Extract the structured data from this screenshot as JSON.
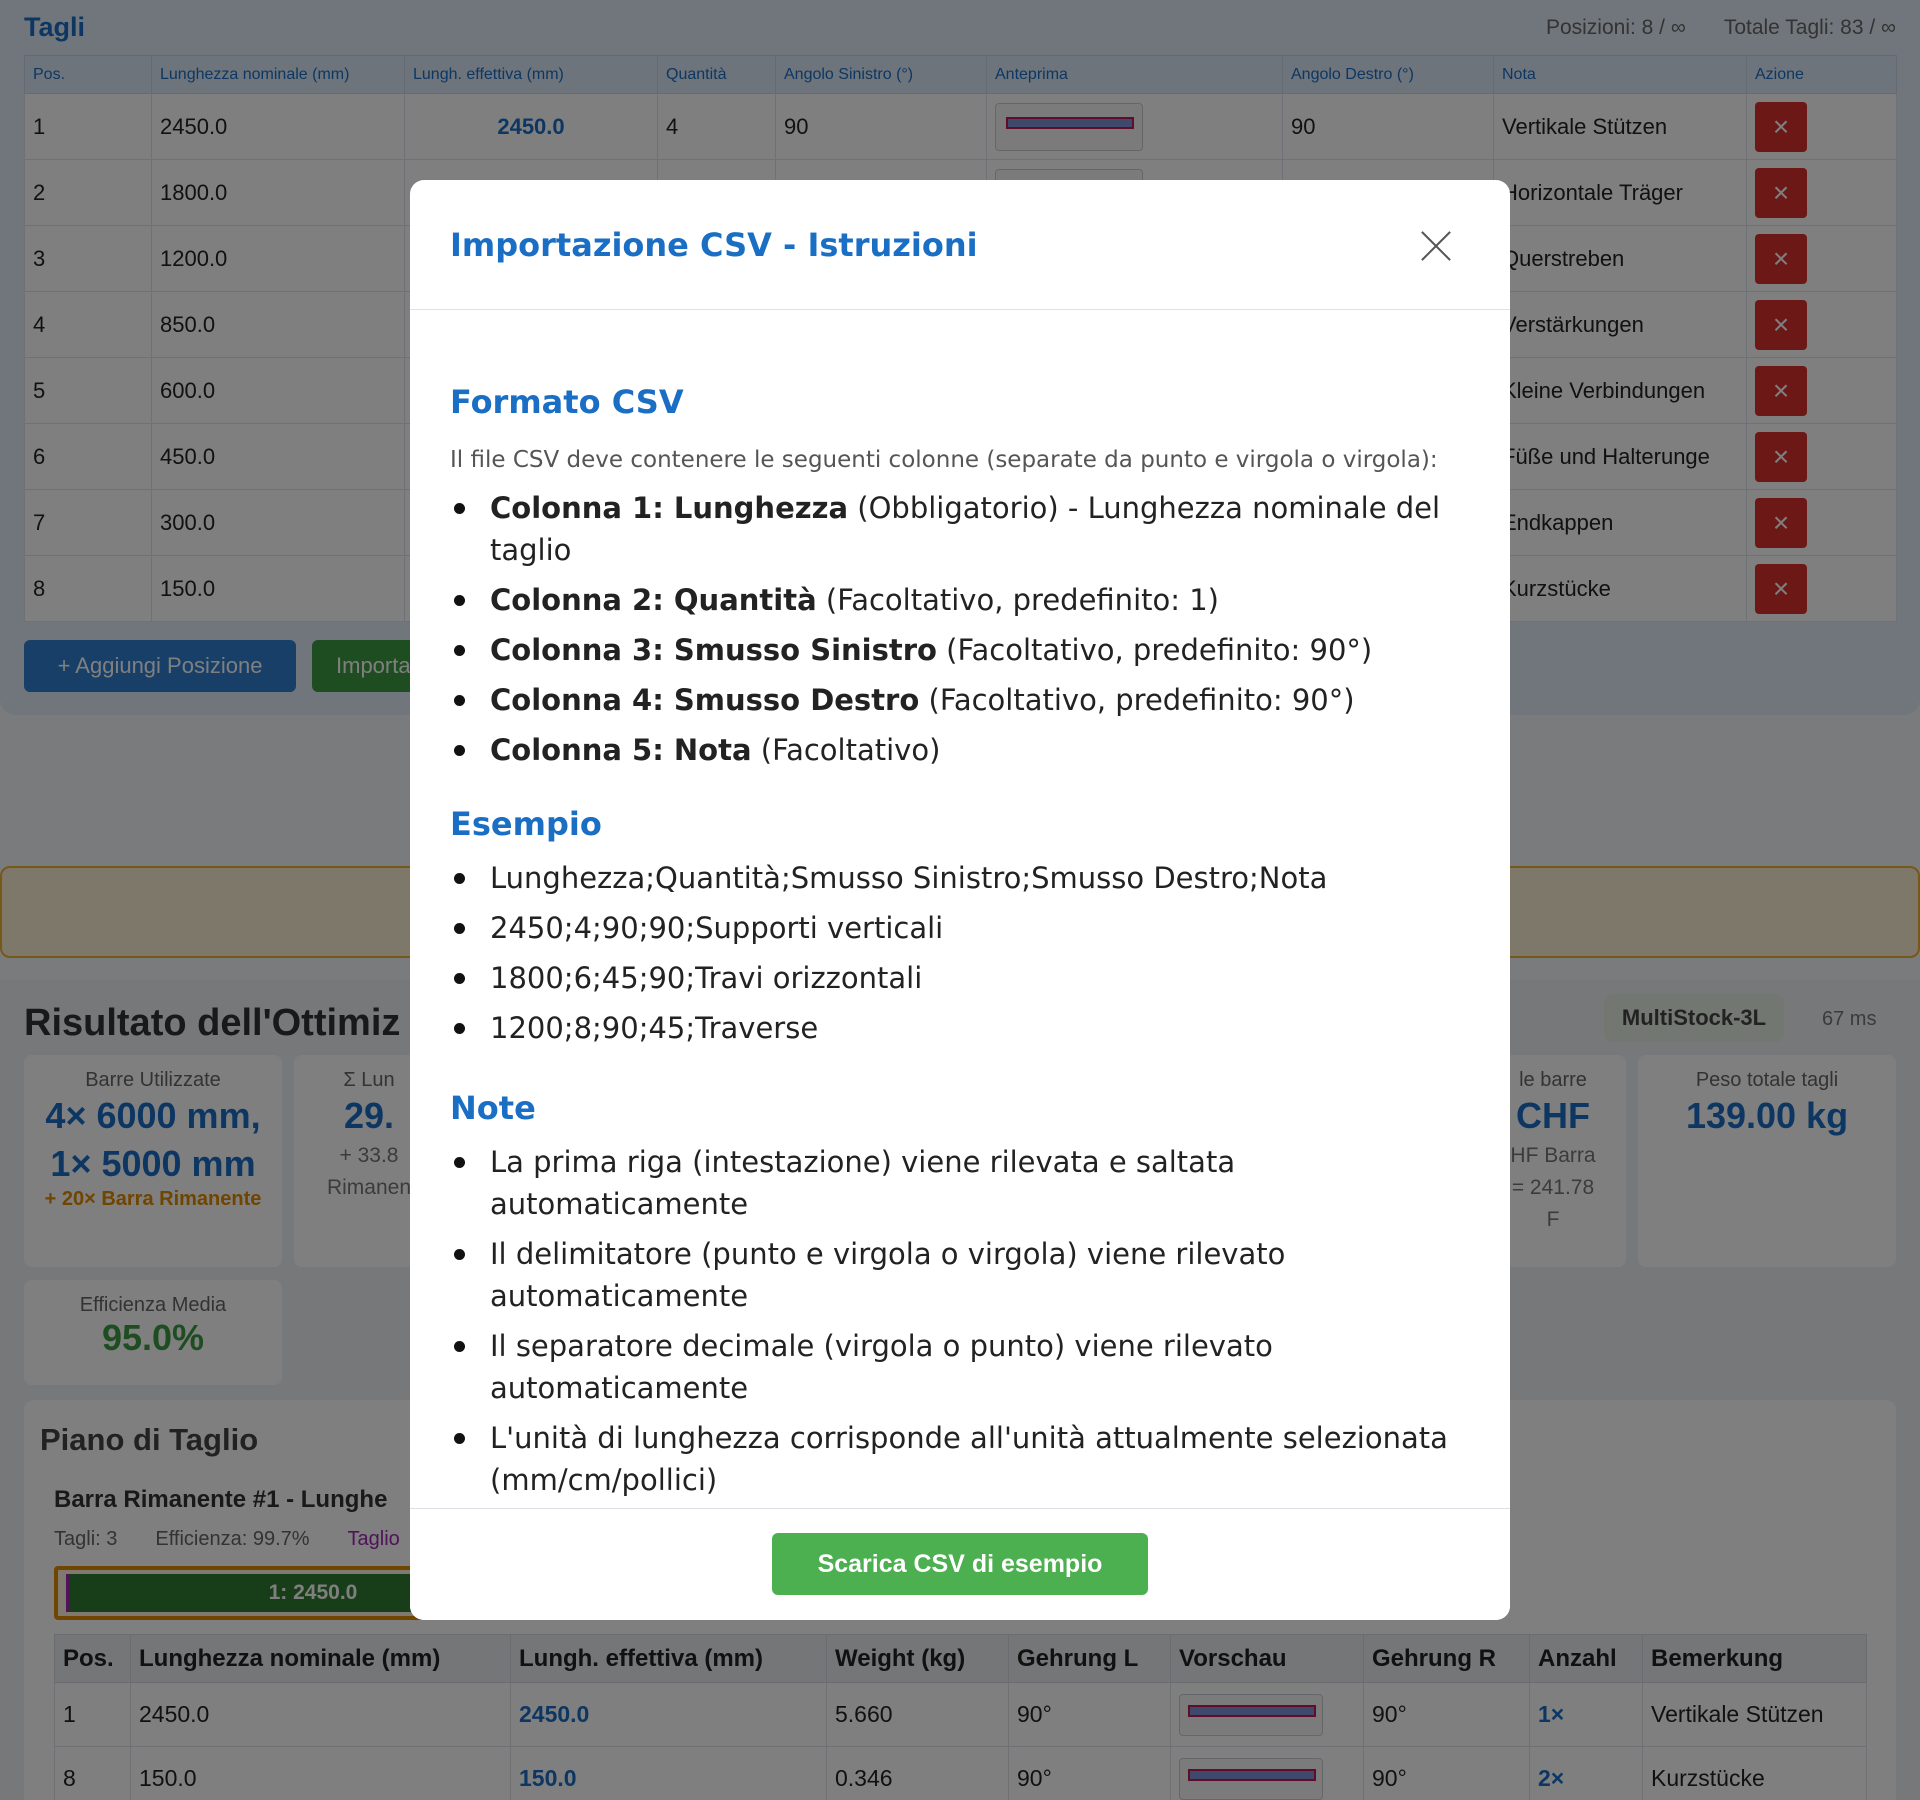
{
  "tagli": {
    "title": "Tagli",
    "positions": "Posizioni: 8 / ∞",
    "total": "Totale Tagli: 83 / ∞",
    "headers": [
      "Pos.",
      "Lunghezza nominale (mm)",
      "Lungh. effettiva (mm)",
      "Quantità",
      "Angolo Sinistro (°)",
      "Anteprima",
      "Angolo Destro (°)",
      "Nota",
      "Azione"
    ],
    "rows": [
      {
        "pos": "1",
        "len": "2450.0",
        "eff": "2450.0",
        "qty": "4",
        "angL": "90",
        "angR": "90",
        "note": "Vertikale Stützen"
      },
      {
        "pos": "2",
        "len": "1800.0",
        "eff": "",
        "qty": "",
        "angL": "",
        "angR": "",
        "note": "Horizontale Träger"
      },
      {
        "pos": "3",
        "len": "1200.0",
        "eff": "",
        "qty": "",
        "angL": "",
        "angR": "",
        "note": "Querstreben"
      },
      {
        "pos": "4",
        "len": "850.0",
        "eff": "",
        "qty": "",
        "angL": "",
        "angR": "",
        "note": "Verstärkungen"
      },
      {
        "pos": "5",
        "len": "600.0",
        "eff": "",
        "qty": "",
        "angL": "",
        "angR": "",
        "note": "Kleine Verbindungen"
      },
      {
        "pos": "6",
        "len": "450.0",
        "eff": "",
        "qty": "",
        "angL": "",
        "angR": "",
        "note": "Füße und Halterunge"
      },
      {
        "pos": "7",
        "len": "300.0",
        "eff": "",
        "qty": "",
        "angL": "",
        "angR": "",
        "note": "Endkappen"
      },
      {
        "pos": "8",
        "len": "150.0",
        "eff": "",
        "qty": "",
        "angL": "",
        "angR": "",
        "note": "Kurzstücke"
      }
    ],
    "delete_icon": "×",
    "add_button": "+ Aggiungi Posizione",
    "import_button": "Importa"
  },
  "results": {
    "title": "Risultato dell'Ottimiz",
    "algorithm": "MultiStock-3L",
    "time": "67 ms",
    "card1": {
      "label": "Barre Utilizzate",
      "line1": "4× 6000 mm,",
      "line2": "1× 5000 mm",
      "sub": "+ 20× Barra Rimanente"
    },
    "card2": {
      "label": "Σ Lun",
      "big": "29.",
      "small1": "+ 33.8",
      "small2": "Rimanen"
    },
    "card3": {
      "label": "le barre",
      "big": "CHF",
      "small1": "HF Barra",
      "small2": "= 241.78",
      "small3": "F"
    },
    "card4": {
      "label": "Peso totale tagli",
      "big": "139.00 kg"
    },
    "card5": {
      "label": "Efficienza Media",
      "big": "95.0%"
    }
  },
  "plan": {
    "title": "Piano di Taglio",
    "bar_name": "Barra Rimanente #1 - Lunghe",
    "meta_cuts": "Tagli: 3",
    "meta_eff": "Efficienza: 99.7%",
    "meta_extra": "Taglio",
    "segment_label": "1: 2450.0",
    "headers": [
      "Pos.",
      "Lunghezza nominale (mm)",
      "Lungh. effettiva (mm)",
      "Weight (kg)",
      "Gehrung L",
      "Vorschau",
      "Gehrung R",
      "Anzahl",
      "Bemerkung"
    ],
    "rows": [
      {
        "pos": "1",
        "len": "2450.0",
        "eff": "2450.0",
        "w": "5.660",
        "gl": "90°",
        "gr": "90°",
        "cnt": "1×",
        "note": "Vertikale Stützen"
      },
      {
        "pos": "8",
        "len": "150.0",
        "eff": "150.0",
        "w": "0.346",
        "gl": "90°",
        "gr": "90°",
        "cnt": "2×",
        "note": "Kurzstücke"
      }
    ]
  },
  "modal": {
    "title": "Importazione CSV - Istruzioni",
    "close_icon": "close-icon",
    "format_title": "Formato CSV",
    "format_intro": "Il file CSV deve contenere le seguenti colonne (separate da punto e virgola o virgola):",
    "columns": [
      {
        "bold": "Colonna 1: Lunghezza",
        "rest": " (Obbligatorio) - Lunghezza nominale del taglio"
      },
      {
        "bold": "Colonna 2: Quantità",
        "rest": " (Facoltativo, predefinito: 1)"
      },
      {
        "bold": "Colonna 3: Smusso Sinistro",
        "rest": " (Facoltativo, predefinito: 90°)"
      },
      {
        "bold": "Colonna 4: Smusso Destro",
        "rest": " (Facoltativo, predefinito: 90°)"
      },
      {
        "bold": "Colonna 5: Nota",
        "rest": " (Facoltativo)"
      }
    ],
    "example_title": "Esempio",
    "example_lines": [
      "Lunghezza;Quantità;Smusso Sinistro;Smusso Destro;Nota",
      "2450;4;90;90;Supporti verticali",
      "1800;6;45;90;Travi orizzontali",
      "1200;8;90;45;Traverse"
    ],
    "notes_title": "Note",
    "notes": [
      "La prima riga (intestazione) viene rilevata e saltata automaticamente",
      "Il delimitatore (punto e virgola o virgola) viene rilevato automaticamente",
      "Il separatore decimale (virgola o punto) viene rilevato automaticamente",
      "L'unità di lunghezza corrisponde all'unità attualmente selezionata (mm/cm/pollici)"
    ],
    "download_button": "Scarica CSV di esempio"
  }
}
